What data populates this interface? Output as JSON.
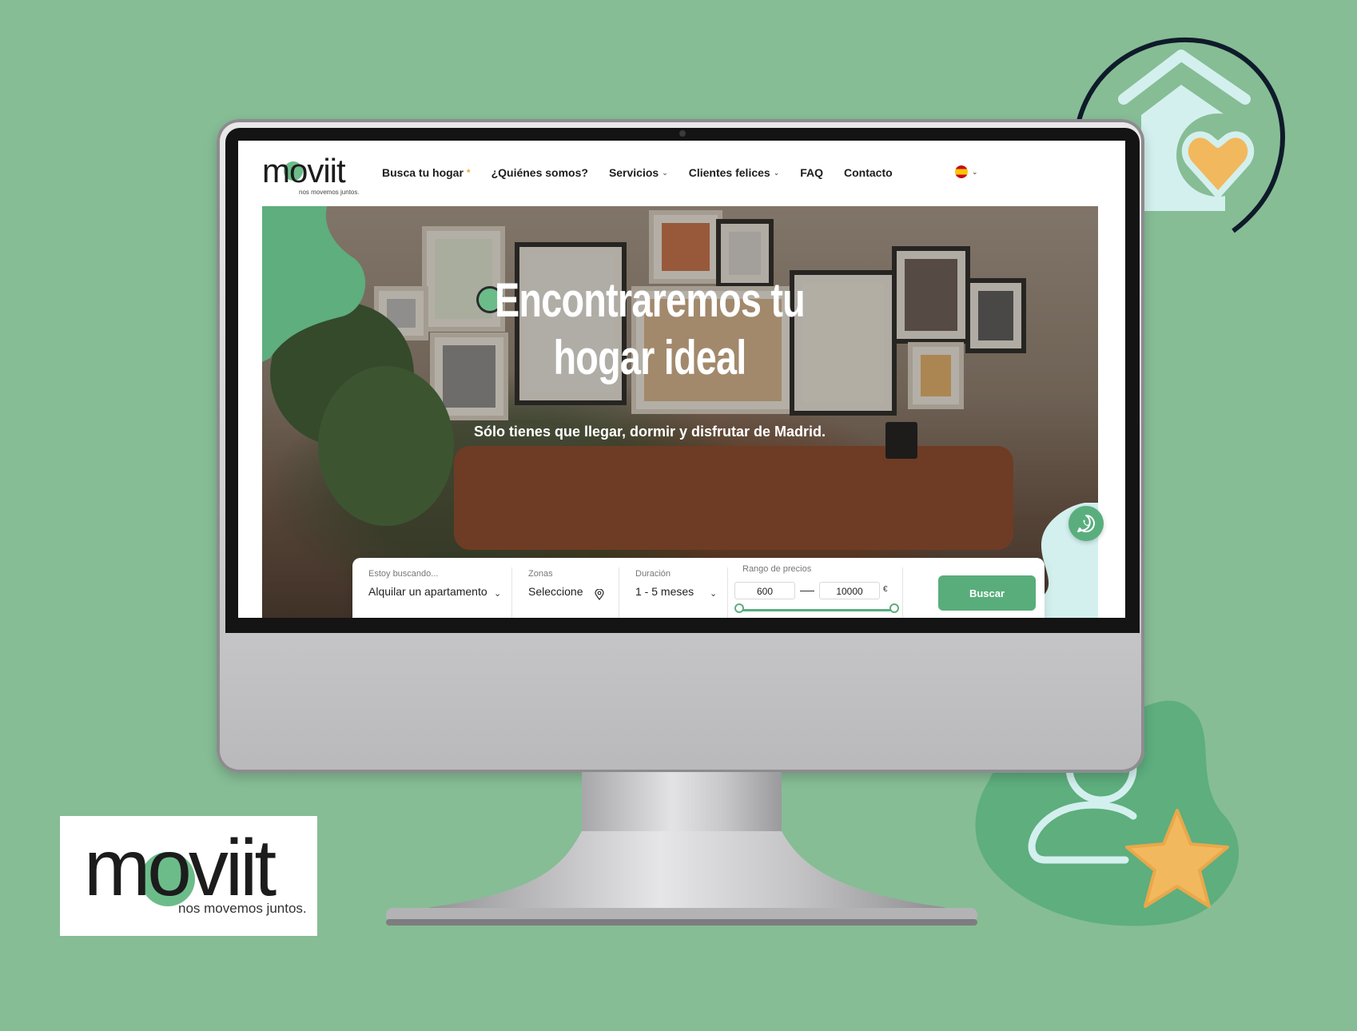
{
  "brand": {
    "name": "moviit",
    "tagline": "nos movemos juntos.",
    "color_green": "#6cbc8a",
    "background": "#86bd95"
  },
  "nav": {
    "items": [
      {
        "label": "Busca tu hogar",
        "badge": "*"
      },
      {
        "label": "¿Quiénes somos?"
      },
      {
        "label": "Servicios",
        "has_dropdown": true
      },
      {
        "label": "Clientes felices",
        "has_dropdown": true
      },
      {
        "label": "FAQ"
      },
      {
        "label": "Contacto"
      }
    ],
    "language_icon": "spain-flag-icon"
  },
  "hero": {
    "title_line1": "Encontraremos tu",
    "title_line2": "hogar ideal",
    "subtitle": "Sólo tienes que llegar, dormir y disfrutar de Madrid."
  },
  "search": {
    "looking_for": {
      "label": "Estoy buscando...",
      "value": "Alquilar un apartamento"
    },
    "zones": {
      "label": "Zonas",
      "value": "Seleccione"
    },
    "duration": {
      "label": "Duración",
      "value": "1 - 5 meses"
    },
    "price_range": {
      "label": "Rango de precios",
      "min": "600",
      "max": "10000",
      "currency": "€"
    },
    "button": "Buscar"
  },
  "icons": [
    "whatsapp-icon",
    "house-heart-icon",
    "user-star-icon",
    "map-pin-icon",
    "chevron-down-icon"
  ]
}
